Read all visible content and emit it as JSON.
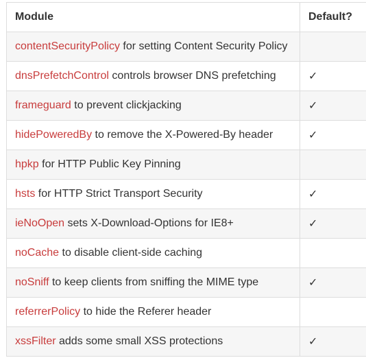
{
  "table": {
    "headers": {
      "module": "Module",
      "default": "Default?"
    },
    "rows": [
      {
        "name": "contentSecurityPolicy",
        "desc": " for setting Content Security Policy",
        "default": ""
      },
      {
        "name": "dnsPrefetchControl",
        "desc": " controls browser DNS prefetching",
        "default": "✓"
      },
      {
        "name": "frameguard",
        "desc": " to prevent clickjacking",
        "default": "✓"
      },
      {
        "name": "hidePoweredBy",
        "desc": " to remove the X-Powered-By header",
        "default": "✓"
      },
      {
        "name": "hpkp",
        "desc": " for HTTP Public Key Pinning",
        "default": ""
      },
      {
        "name": "hsts",
        "desc": " for HTTP Strict Transport Security",
        "default": "✓"
      },
      {
        "name": "ieNoOpen",
        "desc": " sets X-Download-Options for IE8+",
        "default": "✓"
      },
      {
        "name": "noCache",
        "desc": " to disable client-side caching",
        "default": ""
      },
      {
        "name": "noSniff",
        "desc": " to keep clients from sniffing the MIME type",
        "default": "✓"
      },
      {
        "name": "referrerPolicy",
        "desc": " to hide the Referer header",
        "default": ""
      },
      {
        "name": "xssFilter",
        "desc": " adds some small XSS protections",
        "default": "✓"
      }
    ]
  },
  "colors": {
    "link": "#c83c3c",
    "text": "#333333",
    "row_alt": "#f6f6f6",
    "border": "#dddddd"
  }
}
